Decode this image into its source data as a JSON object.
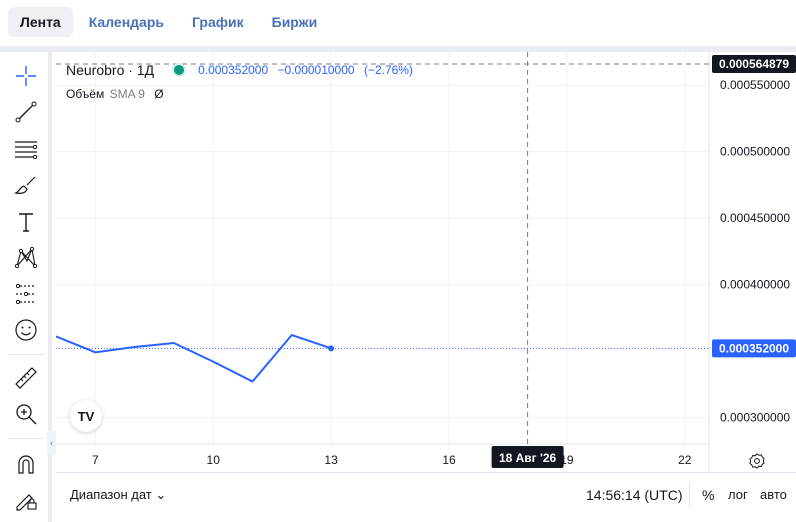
{
  "tabs": [
    {
      "label": "Лента",
      "active": true
    },
    {
      "label": "Календарь",
      "active": false
    },
    {
      "label": "График",
      "active": false
    },
    {
      "label": "Биржи",
      "active": false
    }
  ],
  "legend": {
    "symbol": "Neurobro · 1Д",
    "price": "0.000352000",
    "change": "−0.000010000",
    "change_pct": "(−2.76%)",
    "volume_label": "Объём",
    "indicator": "SMA 9",
    "indicator_value": "Ø"
  },
  "price_axis": {
    "crosshair_label": "0.000564879",
    "current_label": "0.000352000"
  },
  "time_axis": {
    "crosshair_label": "18 Авг '26"
  },
  "bottom": {
    "range_label": "Диапазон дат",
    "time": "14:56:14 (UTC)",
    "pct": "%",
    "log": "лог",
    "auto": "авто"
  },
  "tools": [
    "crosshair-icon",
    "trend-line-icon",
    "fib-icon",
    "brush-icon",
    "text-icon",
    "pattern-icon",
    "forecast-icon",
    "emoji-icon",
    "ruler-icon",
    "zoom-icon",
    "magnet-icon",
    "lock-draw-icon"
  ],
  "colors": {
    "accent": "#2962ff",
    "live": "#089981",
    "crosshair_bg": "#131722"
  },
  "chart_data": {
    "type": "line",
    "series": [
      {
        "name": "",
        "x": [
          "6",
          "7",
          "8",
          "9",
          "10",
          "11",
          "12",
          "13"
        ],
        "values": [
          0.000361,
          0.000349,
          0.000353,
          0.000356,
          0.000342,
          0.000327,
          0.000362,
          0.000352
        ]
      }
    ],
    "x_ticks": [
      "7",
      "10",
      "13",
      "16",
      "19",
      "22"
    ],
    "y_ticks": [
      "0.000550000",
      "0.000500000",
      "0.000450000",
      "0.000400000",
      "0.000300000"
    ],
    "ylim": [
      0.00028,
      0.000575
    ],
    "grid": true
  }
}
